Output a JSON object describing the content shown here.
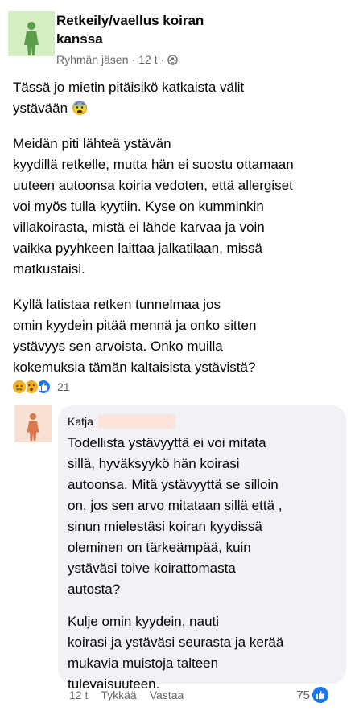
{
  "post": {
    "group_name": "Retkeily/vaellus koiran kanssa",
    "group_name_line1": "Retkeily/vaellus koiran",
    "group_name_line2": "kanssa",
    "author_role": "Ryhmän jäsen",
    "timestamp": "12 t",
    "separator": "·",
    "paragraphs": [
      [
        "Tässä jo mietin pitäisikö katkaista välit",
        "ystävään 😨"
      ],
      [
        "Meidän piti lähteä ystävän",
        "kyydillä retkelle, mutta hän ei suostu ottamaan",
        "uuteen autoonsa koiria vedoten, että allergiset",
        "voi myös tulla kyytiin. Kyse on kumminkin",
        "villakoirasta, mistä ei lähde karvaa ja voin",
        "vaikka pyyhkeen laittaa jalkatilaan, missä",
        "matkustaisi."
      ],
      [
        "Kyllä latistaa retken tunnelmaa jos",
        "omin kyydein pitää mennä ja onko sitten",
        "ystävyys sen arvoista. Onko muilla",
        "kokemuksia tämän kaltaisista ystävistä?"
      ]
    ],
    "reactions": {
      "icons": [
        "sad-reaction-icon",
        "wow-reaction-icon",
        "like-reaction-icon"
      ],
      "count": "21"
    }
  },
  "comment": {
    "author": "Katja",
    "paragraphs": [
      [
        "Todellista ystävyyttä ei voi mitata",
        "sillä, hyväksyykö hän koirasi",
        "autoonsa. Mitä ystävyyttä se silloin",
        "on, jos sen arvo mitataan sillä että ,",
        "sinun mielestäsi koiran kyydissä",
        "oleminen on tärkeämpää, kuin",
        "ystäväsi toive koirattomasta",
        "autosta?"
      ],
      [
        "Kulje omin kyydein, nauti",
        "koirasi ja ystäväsi seurasta ja kerää",
        "mukavia muistoja talteen",
        "tulevaisuuteen."
      ]
    ],
    "time": "12 t",
    "like_label": "Tykkää",
    "reply_label": "Vastaa",
    "like_count": "75"
  },
  "colors": {
    "group_avatar_bg": "#d4eec1",
    "group_avatar_figure": "#5a9e4a",
    "comment_avatar_bg": "#f9e1d3",
    "comment_avatar_figure": "#d9784d",
    "bubble_bg": "#f0f2f5",
    "like_blue": "#1877f2",
    "secondary_text": "#65676b"
  }
}
